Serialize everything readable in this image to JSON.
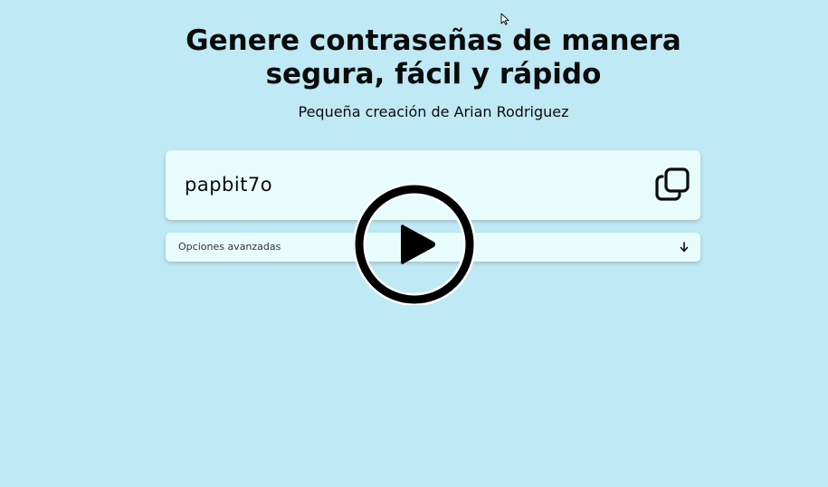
{
  "header": {
    "title_line1": "Genere contraseñas de manera",
    "title_line2": "segura, fácil y rápido",
    "subtitle": "Pequeña creación de Arian Rodriguez"
  },
  "generator": {
    "password": "papbit7o",
    "copy_icon": "copy-icon"
  },
  "options": {
    "label": "Opciones avanzadas",
    "expand_icon": "arrow-down-icon"
  },
  "overlay": {
    "play_icon": "play-icon"
  },
  "colors": {
    "background": "#bfe9f5",
    "card": "#e9fcfd",
    "text": "#0b0b0b"
  }
}
